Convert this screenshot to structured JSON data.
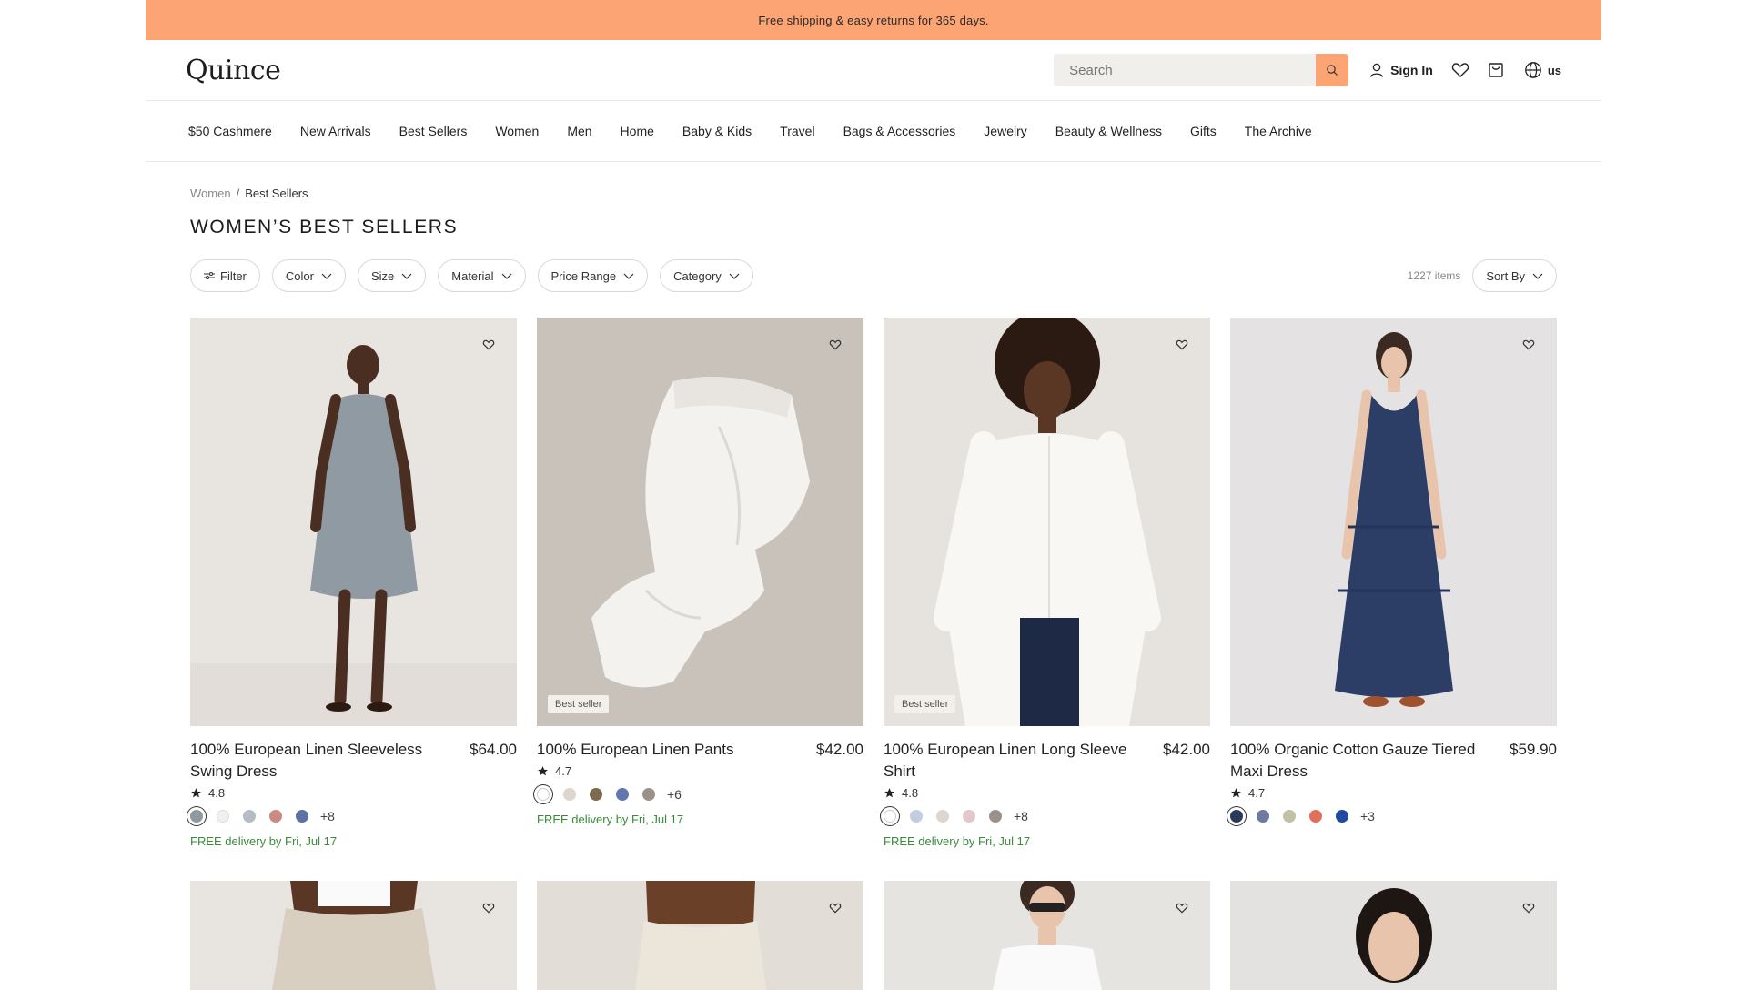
{
  "promo": {
    "text": "Free shipping & easy returns for 365 days."
  },
  "header": {
    "logo": "Quince",
    "search_placeholder": "Search",
    "sign_in": "Sign In",
    "locale": "us"
  },
  "nav": {
    "items": [
      "$50 Cashmere",
      "New Arrivals",
      "Best Sellers",
      "Women",
      "Men",
      "Home",
      "Baby & Kids",
      "Travel",
      "Bags & Accessories",
      "Jewelry",
      "Beauty & Wellness",
      "Gifts",
      "The Archive"
    ]
  },
  "breadcrumb": {
    "parent": "Women",
    "separator": "/",
    "current": "Best Sellers"
  },
  "page_title": "WOMEN’S BEST SELLERS",
  "filters": {
    "filter": "Filter",
    "color": "Color",
    "size": "Size",
    "material": "Material",
    "price_range": "Price Range",
    "category": "Category",
    "items_count": "1227 items",
    "sort_by": "Sort By"
  },
  "accent_color": "#fca474",
  "delivery_color": "#3a8a3a",
  "products": [
    {
      "name": "100% European Linen Sleeveless Swing Dress",
      "price": "$64.00",
      "rating": "4.8",
      "badge": "",
      "swatches": [
        "#8e9aa0",
        "#eef0f2",
        "#b5bcc6",
        "#c98a80",
        "#5d6fa3"
      ],
      "more": "+8",
      "delivery": "FREE delivery by Fri, Jul 17"
    },
    {
      "name": "100% European Linen Pants",
      "price": "$42.00",
      "rating": "4.7",
      "badge": "Best seller",
      "swatches": [
        "#ffffff",
        "#ddd6ce",
        "#7a6a4e",
        "#6277b0",
        "#9a928a"
      ],
      "more": "+6",
      "delivery": "FREE delivery by Fri, Jul 17"
    },
    {
      "name": "100% European Linen Long Sleeve Shirt",
      "price": "$42.00",
      "rating": "4.8",
      "badge": "Best seller",
      "swatches": [
        "#ffffff",
        "#c6cce0",
        "#ddd6ce",
        "#e2c8cc",
        "#9a928a"
      ],
      "more": "+8",
      "delivery": "FREE delivery by Fri, Jul 17"
    },
    {
      "name": "100% Organic Cotton Gauze Tiered Maxi Dress",
      "price": "$59.90",
      "rating": "4.7",
      "badge": "",
      "swatches": [
        "#2b3a5c",
        "#6c7a9e",
        "#c4c0a6",
        "#e0705a",
        "#1f4aa0"
      ],
      "more": "+3",
      "delivery": ""
    }
  ]
}
